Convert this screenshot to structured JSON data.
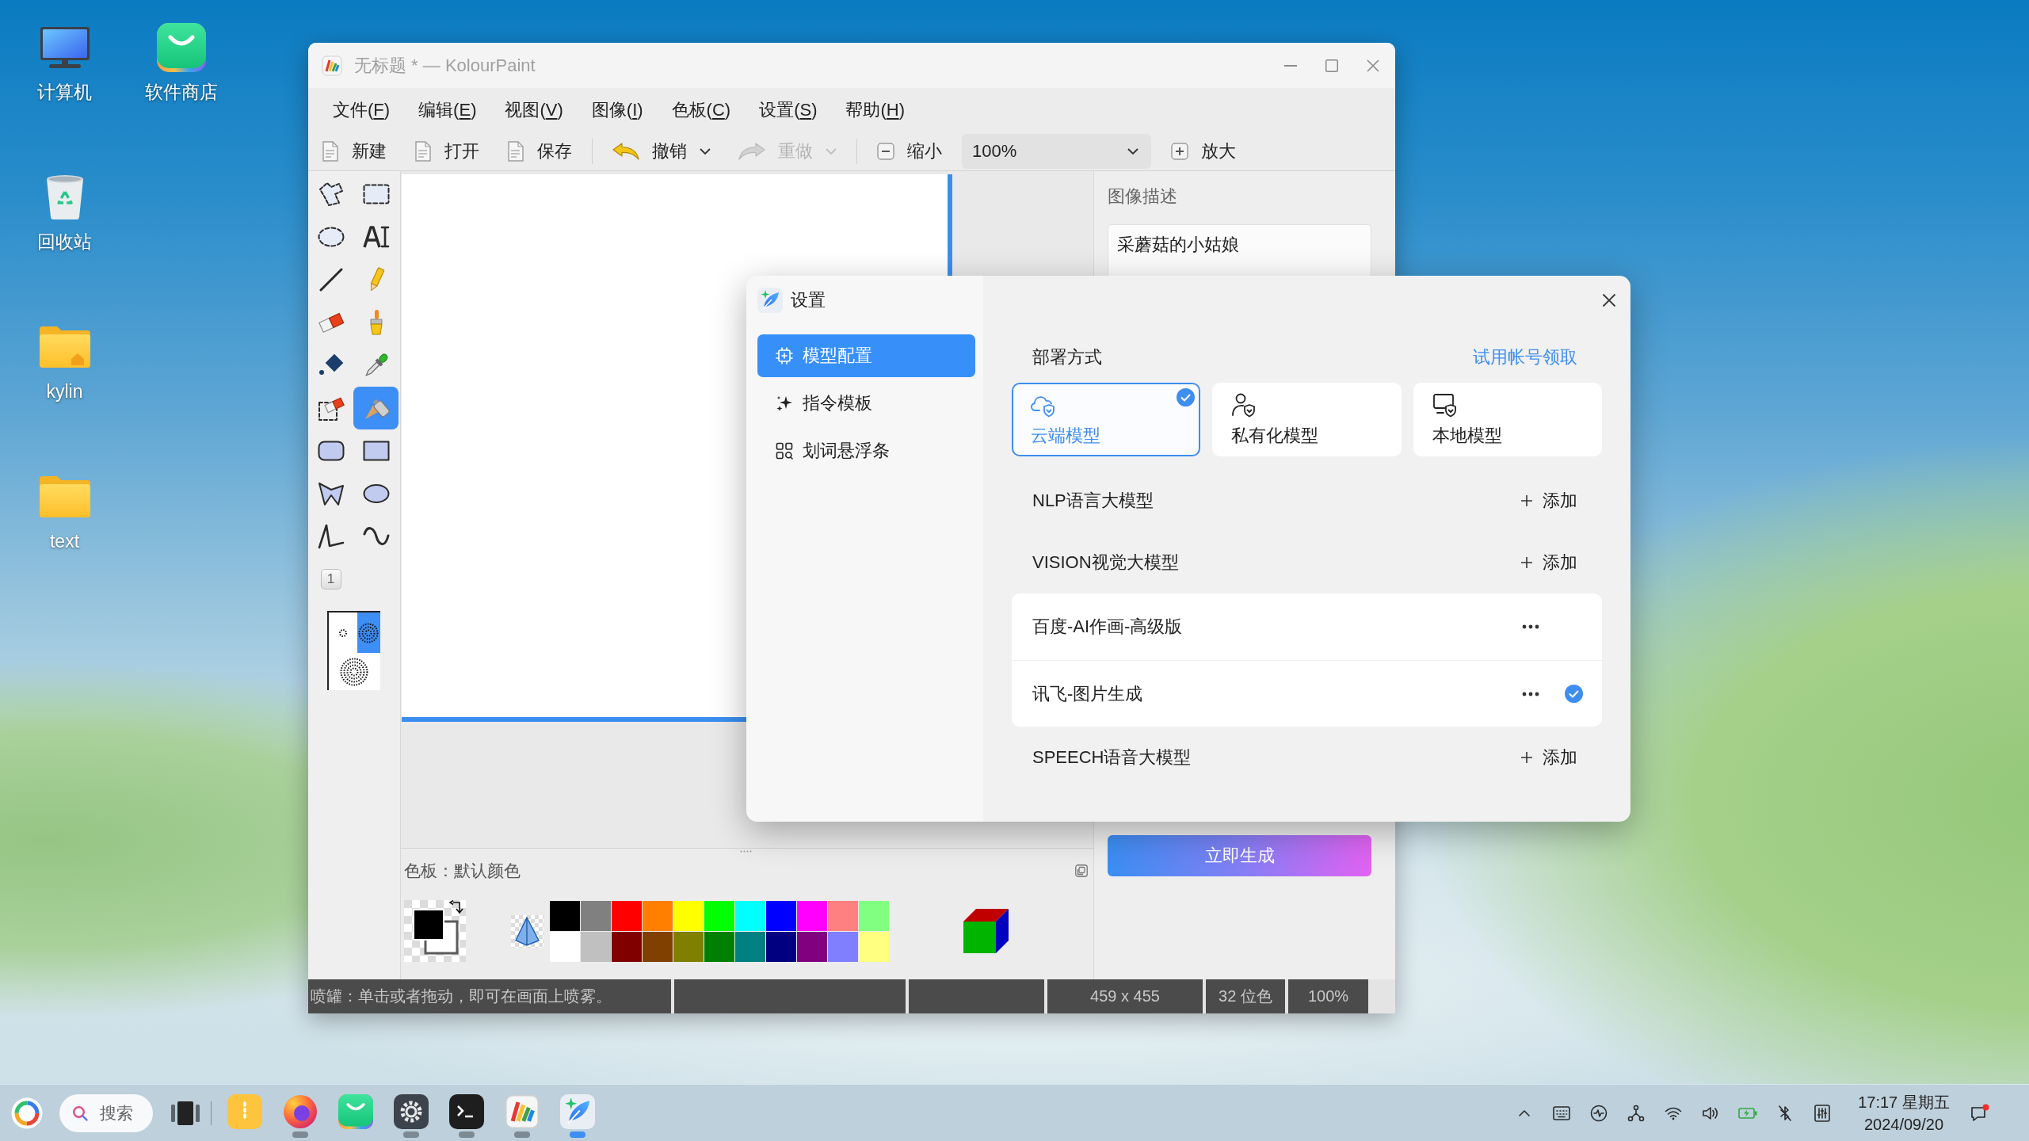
{
  "desktop": {
    "icons": [
      {
        "label": "计算机",
        "kind": "computer"
      },
      {
        "label": "回收站",
        "kind": "trash"
      },
      {
        "label": "kylin",
        "kind": "home-folder"
      },
      {
        "label": "text",
        "kind": "folder"
      },
      {
        "label": "软件商店",
        "kind": "store"
      }
    ]
  },
  "paint_window": {
    "title": "无标题 * — KolourPaint",
    "focused": false,
    "menu": [
      {
        "before": "文件(",
        "accel": "F",
        "after": ")"
      },
      {
        "before": "编辑(",
        "accel": "E",
        "after": ")"
      },
      {
        "before": "视图(",
        "accel": "V",
        "after": ")"
      },
      {
        "before": "图像(",
        "accel": "I",
        "after": ")"
      },
      {
        "before": "色板(",
        "accel": "C",
        "after": ")"
      },
      {
        "before": "设置(",
        "accel": "S",
        "after": ")"
      },
      {
        "before": "帮助(",
        "accel": "H",
        "after": ")"
      }
    ],
    "toolbar": [
      {
        "kind": "new",
        "label": "新建",
        "disabled": false
      },
      {
        "kind": "open",
        "label": "打开",
        "disabled": false
      },
      {
        "kind": "save",
        "label": "保存",
        "disabled": false
      },
      {
        "kind": "separator"
      },
      {
        "kind": "undo",
        "label": "撤销",
        "disabled": false,
        "dropdown": true
      },
      {
        "kind": "redo",
        "label": "重做",
        "disabled": true,
        "dropdown": true
      },
      {
        "kind": "separator"
      },
      {
        "kind": "zoom-out",
        "label": "缩小",
        "disabled": false
      },
      {
        "kind": "zoom-field",
        "value": "100%"
      },
      {
        "kind": "zoom-in",
        "label": "放大",
        "disabled": false
      }
    ],
    "tools": [
      {
        "kind": "free-select",
        "selected": false
      },
      {
        "kind": "rect-select",
        "selected": false
      },
      {
        "kind": "ellipse-select",
        "selected": false
      },
      {
        "kind": "text",
        "selected": false
      },
      {
        "kind": "line",
        "selected": false
      },
      {
        "kind": "pencil",
        "selected": false
      },
      {
        "kind": "eraser",
        "selected": false
      },
      {
        "kind": "brush",
        "selected": false
      },
      {
        "kind": "fill",
        "selected": false
      },
      {
        "kind": "color-picker",
        "selected": false
      },
      {
        "kind": "color-eraser",
        "selected": false
      },
      {
        "kind": "spraycan",
        "selected": true
      },
      {
        "kind": "rounded-rect",
        "selected": false
      },
      {
        "kind": "rect",
        "selected": false
      },
      {
        "kind": "polygon",
        "selected": false
      },
      {
        "kind": "ellipse",
        "selected": false
      },
      {
        "kind": "polyline",
        "selected": false
      },
      {
        "kind": "curve",
        "selected": false
      }
    ],
    "tool_option_label": "1",
    "spray_sizes": [
      {
        "kind": "small",
        "selected": false
      },
      {
        "kind": "medium",
        "selected": true
      },
      {
        "kind": "large",
        "selected": false
      }
    ],
    "palette": {
      "title": "色板：默认颜色",
      "swatches": [
        {
          "color": "#000000"
        },
        {
          "color": "#808080"
        },
        {
          "color": "#ff0000"
        },
        {
          "color": "#ff8000"
        },
        {
          "color": "#ffff00"
        },
        {
          "color": "#00ff00"
        },
        {
          "color": "#00ffff"
        },
        {
          "color": "#0000ff"
        },
        {
          "color": "#ff00ff"
        },
        {
          "color": "#ff8080"
        },
        {
          "color": "#80ff80"
        },
        {
          "color": "#ffffff"
        },
        {
          "color": "#c0c0c0"
        },
        {
          "color": "#800000"
        },
        {
          "color": "#804000"
        },
        {
          "color": "#808000"
        },
        {
          "color": "#008000"
        },
        {
          "color": "#008080"
        },
        {
          "color": "#000080"
        },
        {
          "color": "#800080"
        },
        {
          "color": "#8080ff"
        },
        {
          "color": "#ffff80"
        }
      ]
    },
    "side_panel": {
      "heading": "图像描述",
      "description": "采蘑菇的小姑娘",
      "generate_button": "立即生成"
    },
    "status_bar": {
      "message": "喷罐：单击或者拖动，即可在画面上喷雾。",
      "fields": [
        "459 x 455",
        "32 位色",
        "100%"
      ]
    }
  },
  "settings_dialog": {
    "title": "设置",
    "nav": [
      {
        "label": "模型配置",
        "kind": "model",
        "selected": true
      },
      {
        "label": "指令模板",
        "kind": "prompt",
        "selected": false
      },
      {
        "label": "划词悬浮条",
        "kind": "float",
        "selected": false
      }
    ],
    "section_title": "部署方式",
    "trial_link": "试用帐号领取",
    "deploy_modes": [
      {
        "label": "云端模型",
        "kind": "cloud",
        "selected": true
      },
      {
        "label": "私有化模型",
        "kind": "private",
        "selected": false
      },
      {
        "label": "本地模型",
        "kind": "local",
        "selected": false
      }
    ],
    "categories": [
      {
        "name": "NLP语言大模型",
        "add_label": "添加"
      },
      {
        "name": "VISION视觉大模型",
        "add_label": "添加",
        "models": [
          {
            "name": "百度-AI作画-高级版",
            "selected": false
          },
          {
            "name": "讯飞-图片生成",
            "selected": true
          }
        ]
      },
      {
        "name": "SPEECH语音大模型",
        "add_label": "添加"
      }
    ]
  },
  "taskbar": {
    "search_placeholder": "搜索",
    "apps": [
      {
        "kind": "notes",
        "running": false,
        "active": false
      },
      {
        "kind": "browser",
        "running": true,
        "active": false
      },
      {
        "kind": "store",
        "running": false,
        "active": false
      },
      {
        "kind": "settings",
        "running": true,
        "active": false
      },
      {
        "kind": "terminal",
        "running": true,
        "active": false
      },
      {
        "kind": "paint",
        "running": true,
        "active": false
      },
      {
        "kind": "assistant",
        "running": true,
        "active": true
      }
    ],
    "tray": [
      {
        "kind": "expand"
      },
      {
        "kind": "keyboard"
      },
      {
        "kind": "activity"
      },
      {
        "kind": "network"
      },
      {
        "kind": "wifi"
      },
      {
        "kind": "volume"
      },
      {
        "kind": "battery"
      },
      {
        "kind": "bluetooth-off"
      },
      {
        "kind": "controls"
      }
    ],
    "time": "17:17 星期五",
    "date": "2024/09/20",
    "notification_unread": true
  }
}
